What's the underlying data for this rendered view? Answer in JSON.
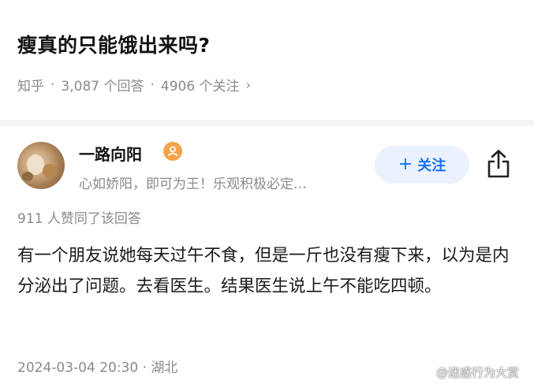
{
  "question": {
    "title": "瘦真的只能饿出来吗?",
    "meta": {
      "platform": "知乎",
      "answers": "3,087 个回答",
      "followers": "4906 个关注",
      "chevron": "›"
    }
  },
  "author": {
    "name": "一路向阳",
    "bio": "心如娇阳，即可为王！乐观积极必定…",
    "badge_icon": "user-badge-icon",
    "follow_label": "关注",
    "follow_symbol": "+"
  },
  "answer": {
    "votes": "911 人赞同了该回答",
    "paragraph": "有一个朋友说她每天过午不食，但是一斤也没有瘦下来，以为是内分泌出了问题。去看医生。结果医生说上午不能吃四顿。",
    "timestamp": "2024-03-04 20:30 · 湖北"
  },
  "watermark": {
    "text": "@迷惑行为大赏",
    "icon": "weibo-icon"
  },
  "colors": {
    "accent": "#1772f6",
    "follow_bg": "#ebf2fe",
    "meta_text": "#8a8a8a",
    "badge": "#f5a34a"
  }
}
